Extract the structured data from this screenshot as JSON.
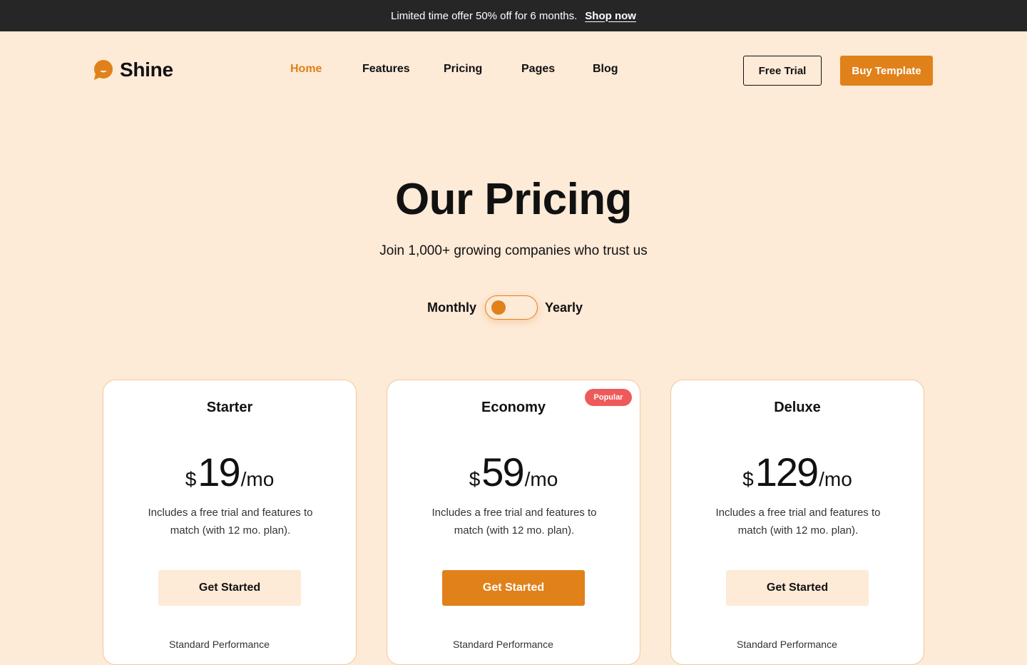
{
  "announcement": {
    "message": "Limited time offer 50% off for 6 months.",
    "link": "Shop now"
  },
  "brand": {
    "name": "Shine",
    "accent": "#E0811A"
  },
  "nav": {
    "items": [
      {
        "label": "Home",
        "active": true
      },
      {
        "label": "Features"
      },
      {
        "label": "Pricing"
      },
      {
        "label": "Pages"
      },
      {
        "label": "Blog"
      }
    ],
    "free_trial": "Free Trial",
    "buy_template": "Buy Template"
  },
  "hero": {
    "title": "Our Pricing",
    "subtitle": "Join 1,000+ growing companies who trust us"
  },
  "billing_toggle": {
    "monthly": "Monthly",
    "yearly": "Yearly",
    "selected": "Monthly"
  },
  "plans": [
    {
      "name": "Starter",
      "currency": "$",
      "amount": "19",
      "period": "/mo",
      "description": "Includes a free trial and features to match (with 12 mo. plan).",
      "cta": "Get Started",
      "feature": "Standard Performance"
    },
    {
      "name": "Economy",
      "badge": "Popular",
      "currency": "$",
      "amount": "59",
      "period": "/mo",
      "description": "Includes a free trial and features to match (with 12 mo. plan).",
      "cta": "Get Started",
      "feature": "Standard Performance"
    },
    {
      "name": "Deluxe",
      "currency": "$",
      "amount": "129",
      "period": "/mo",
      "description": "Includes a free trial and features to match (with 12 mo. plan).",
      "cta": "Get Started",
      "feature": "Standard Performance"
    }
  ]
}
